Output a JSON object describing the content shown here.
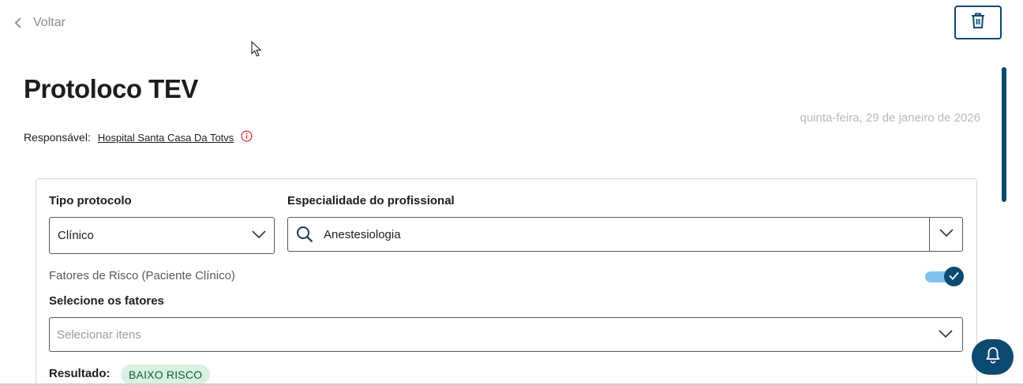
{
  "nav": {
    "back_label": "Voltar"
  },
  "header": {
    "title": "Protoloco TEV",
    "date": "quinta-feira, 29 de janeiro de 2026"
  },
  "responsavel": {
    "label": "Responsável:",
    "link": "Hospital Santa Casa Da Totvs"
  },
  "form": {
    "tipo_protocolo": {
      "label": "Tipo protocolo",
      "value": "Clínico"
    },
    "especialidade": {
      "label": "Especialidade do profissional",
      "value": "Anestesiologia"
    },
    "fatores": {
      "section_title": "Fatores de Risco (Paciente Clínico)",
      "toggle_on": true
    },
    "selecione": {
      "label": "Selecione os fatores",
      "placeholder": "Selecionar itens"
    },
    "resultado": {
      "label": "Resultado:",
      "badge": "BAIXO RISCO"
    }
  },
  "colors": {
    "primary": "#0c4a70",
    "toggle_track": "#7ec3ee",
    "badge_bg": "#d9f1e2",
    "badge_text": "#0e5e2e",
    "info_icon": "#d0312d"
  },
  "icons": [
    "chevron-left-icon",
    "trash-icon",
    "cursor-icon",
    "info-icon",
    "chevron-down-icon",
    "search-icon",
    "check-icon",
    "bell-icon"
  ]
}
